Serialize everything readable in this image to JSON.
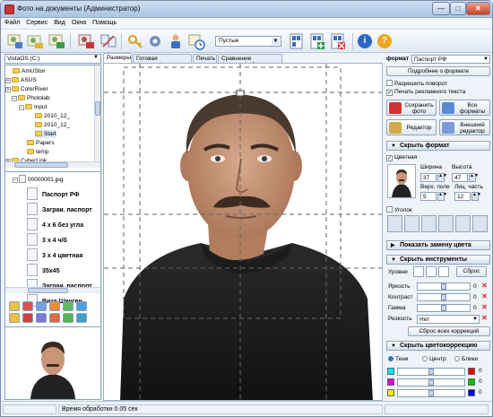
{
  "window": {
    "title": "Фото на документы  (Администратор)",
    "minimize_label": "—",
    "maximize_label": "□",
    "close_label": "✕"
  },
  "menu": [
    "Файл",
    "Сервис",
    "Вид",
    "Окна",
    "Помощь"
  ],
  "toolbar": {
    "preset_select": "Пустые",
    "info_label": "i",
    "help_label": "?"
  },
  "drive": "VistaOS (C:)",
  "tree": [
    {
      "label": "AmUStor",
      "depth": 1
    },
    {
      "label": "ASUS",
      "depth": 1
    },
    {
      "label": "ColorRiver",
      "depth": 1
    },
    {
      "label": "Photolab",
      "depth": 2
    },
    {
      "label": "Input",
      "depth": 3
    },
    {
      "label": "2010_12_",
      "depth": 4
    },
    {
      "label": "2010_12_",
      "depth": 4
    },
    {
      "label": "Start",
      "depth": 4
    },
    {
      "label": "Papers",
      "depth": 3
    },
    {
      "label": "temp",
      "depth": 3
    },
    {
      "label": "CyberLink",
      "depth": 1
    }
  ],
  "formats": {
    "root": "00000001.jpg",
    "items": [
      "Паспорт РФ",
      "Заграи. паспорт",
      "4 x 6 без угла",
      "3 x 4 ч/б",
      "3 x 4 цветная",
      "35x45",
      "Заграи. паспорт",
      "Виза Шенген"
    ]
  },
  "tabs": [
    "Размеры",
    "Готовая фотография",
    "Печать",
    "Сравнение фотографий"
  ],
  "right": {
    "format_label": "формат",
    "format_value": "Паспорт РФ",
    "about_format": "Подробнее о формате",
    "allow_rotate": "Разрешить поворот",
    "print_ad": "Печать рекламного текста",
    "save_photo": "Сохранить фото",
    "all_formats": "Все форматы",
    "editor": "Редактор",
    "ext_editor": "Внешний редактор",
    "hide_format": "Скрыть формат",
    "colored": "Цветная",
    "width_label": "Ширина",
    "height_label": "Высота",
    "width_value": "37",
    "height_value": "47",
    "top_margin_label": "Верх. поле",
    "face_part_label": "Лиц. часть",
    "top_margin_value": "5",
    "face_part_value": "12",
    "corner": "Уголок",
    "show_color_replace": "Показать замену цвета",
    "hide_tools": "Скрыть инструменты",
    "levels": "Уровни",
    "reset": "Сброс",
    "brightness": "Яркость",
    "contrast": "Контраст",
    "gamma": "Гамма",
    "sharpness": "Резкость",
    "sharpness_value": "Нет",
    "zero": "0",
    "reset_all": "Сброс всех коррекций",
    "hide_color_corr": "Скрыть цветокоррекцию",
    "shadows": "Тени",
    "center": "Центр",
    "highlights": "Блики"
  },
  "status": {
    "processing_time": "Время обработки 0.05 сек"
  },
  "colors": {
    "accent": "#3a6fc4",
    "title_bg": "#aac4e3",
    "close": "#c8402a",
    "cyan": "#00e5ff",
    "magenta": "#e000e0",
    "yellow": "#f0f000",
    "red": "#e00000",
    "green": "#00c000",
    "blue": "#0000e0"
  }
}
